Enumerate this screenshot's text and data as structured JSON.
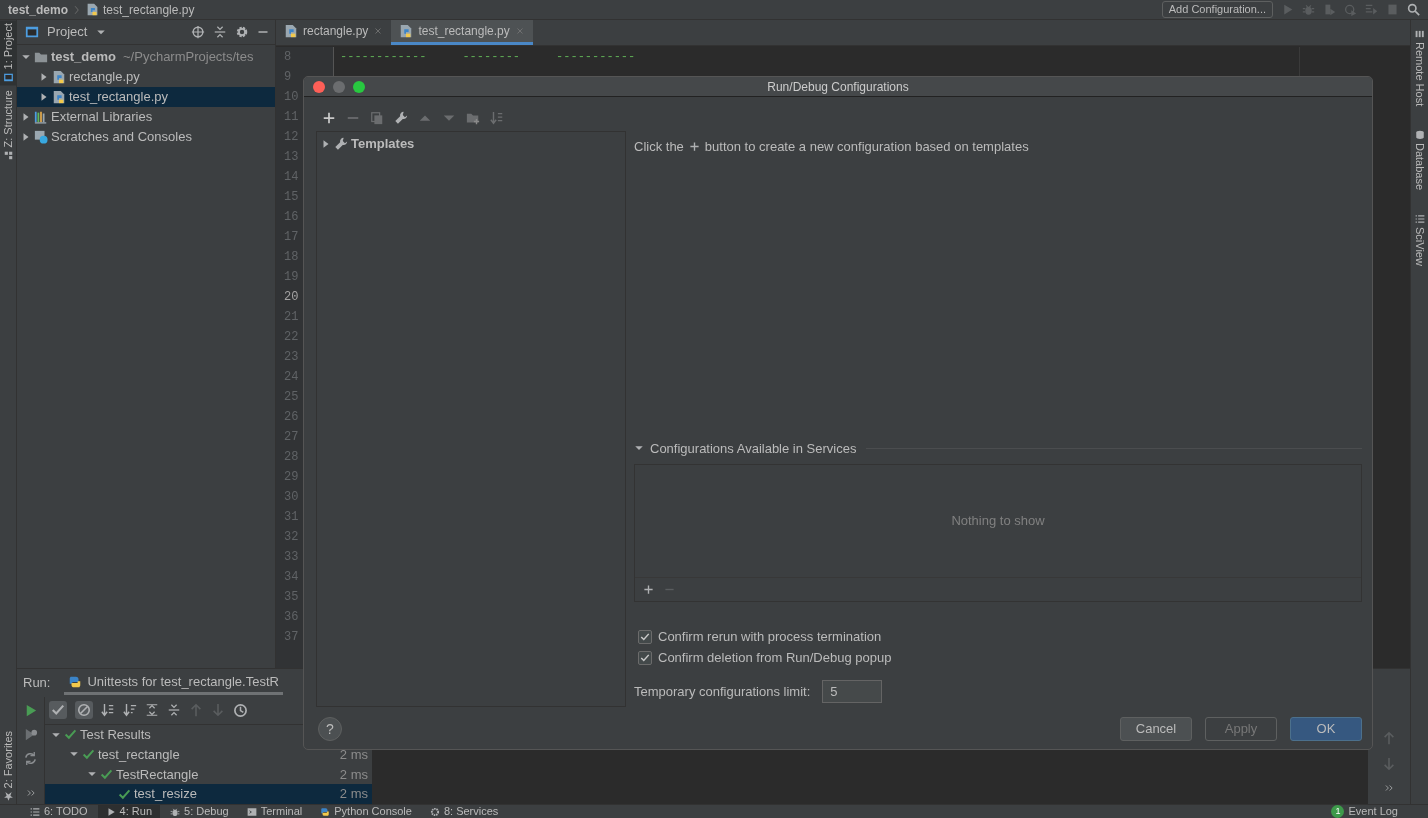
{
  "breadcrumb": [
    "test_demo",
    "test_rectangle.py"
  ],
  "run_config_button": "Add Configuration...",
  "left_strip": [
    {
      "label": "1: Project",
      "selected": true
    },
    {
      "label": "Z: Structure",
      "selected": false
    },
    {
      "label": "2: Favorites",
      "selected": false
    }
  ],
  "right_strip": [
    "Remote Host",
    "Database",
    "SciView"
  ],
  "project_panel": {
    "title": "Project",
    "tree": [
      {
        "label": "test_demo",
        "detail": "~/PycharmProjects/tes",
        "kind": "folder",
        "expanded": true,
        "selected": false,
        "children": [
          {
            "label": "rectangle.py",
            "kind": "python",
            "expanded": false,
            "selected": false
          },
          {
            "label": "test_rectangle.py",
            "kind": "python",
            "expanded": false,
            "selected": true
          }
        ]
      },
      {
        "label": "External Libraries",
        "kind": "libraries",
        "expanded": false,
        "selected": false
      },
      {
        "label": "Scratches and Consoles",
        "kind": "scratches",
        "expanded": false,
        "selected": false
      }
    ]
  },
  "editor": {
    "tabs": [
      {
        "label": "rectangle.py",
        "selected": false
      },
      {
        "label": "test_rectangle.py",
        "selected": true
      }
    ],
    "lines": [
      {
        "number": "8",
        "text": "------------     --------     -----------",
        "current": false
      },
      {
        "number": "9",
        "current": false
      },
      {
        "number": "10",
        "current": false
      },
      {
        "number": "11",
        "current": false
      },
      {
        "number": "12",
        "current": false
      },
      {
        "number": "13",
        "current": false
      },
      {
        "number": "14",
        "current": false
      },
      {
        "number": "15",
        "current": false
      },
      {
        "number": "16",
        "current": false
      },
      {
        "number": "17",
        "current": false
      },
      {
        "number": "18",
        "current": false
      },
      {
        "number": "19",
        "current": false
      },
      {
        "number": "20",
        "current": true
      },
      {
        "number": "21",
        "current": false
      },
      {
        "number": "22",
        "current": false
      },
      {
        "number": "23",
        "current": false
      },
      {
        "number": "24",
        "current": false
      },
      {
        "number": "25",
        "current": false
      },
      {
        "number": "26",
        "current": false
      },
      {
        "number": "27",
        "current": false
      },
      {
        "number": "28",
        "current": false
      },
      {
        "number": "29",
        "current": false
      },
      {
        "number": "30",
        "current": false
      },
      {
        "number": "31",
        "current": false
      },
      {
        "number": "32",
        "current": false
      },
      {
        "number": "33",
        "current": false
      },
      {
        "number": "34",
        "current": false
      },
      {
        "number": "35",
        "current": false
      },
      {
        "number": "36",
        "current": false
      },
      {
        "number": "37",
        "current": false
      }
    ]
  },
  "run_panel": {
    "label": "Run:",
    "tab": "Unittests for test_rectangle.TestR",
    "results": [
      {
        "label": "Test Results",
        "passed": true,
        "expanded": true,
        "selected": false,
        "children": [
          {
            "label": "test_rectangle",
            "time": "2 ms",
            "passed": true,
            "expanded": true,
            "selected": false,
            "children": [
              {
                "label": "TestRectangle",
                "time": "2 ms",
                "passed": true,
                "expanded": true,
                "selected": false,
                "children": [
                  {
                    "label": "test_resize",
                    "time": "2 ms",
                    "passed": true,
                    "selected": true
                  }
                ]
              }
            ]
          }
        ]
      }
    ]
  },
  "bottom_tabs": [
    {
      "label": "6: TODO",
      "kind": "todo",
      "selected": false
    },
    {
      "label": "4: Run",
      "kind": "run",
      "selected": true
    },
    {
      "label": "5: Debug",
      "kind": "debug",
      "selected": false
    },
    {
      "label": "Terminal",
      "kind": "terminal",
      "selected": false
    },
    {
      "label": "Python Console",
      "kind": "console",
      "selected": false
    },
    {
      "label": "8: Services",
      "kind": "services",
      "selected": false
    }
  ],
  "event_log": {
    "label": "Event Log",
    "count": "1"
  },
  "dialog": {
    "title": "Run/Debug Configurations",
    "tree": [
      {
        "label": "Templates",
        "expanded": false
      }
    ],
    "hint": {
      "before": "Click the",
      "after": "button to create a new configuration based on templates"
    },
    "services": {
      "title": "Configurations Available in Services",
      "expanded": true,
      "empty_text": "Nothing to show"
    },
    "options": [
      {
        "label": "Confirm rerun with process termination",
        "checked": true
      },
      {
        "label": "Confirm deletion from Run/Debug popup",
        "checked": true
      }
    ],
    "limit": {
      "label": "Temporary configurations limit:",
      "value": "5"
    },
    "help": "?",
    "buttons": [
      {
        "label": "Cancel",
        "kind": "default",
        "disabled": false
      },
      {
        "label": "Apply",
        "kind": "default",
        "disabled": true
      },
      {
        "label": "OK",
        "kind": "primary",
        "disabled": false
      }
    ]
  }
}
